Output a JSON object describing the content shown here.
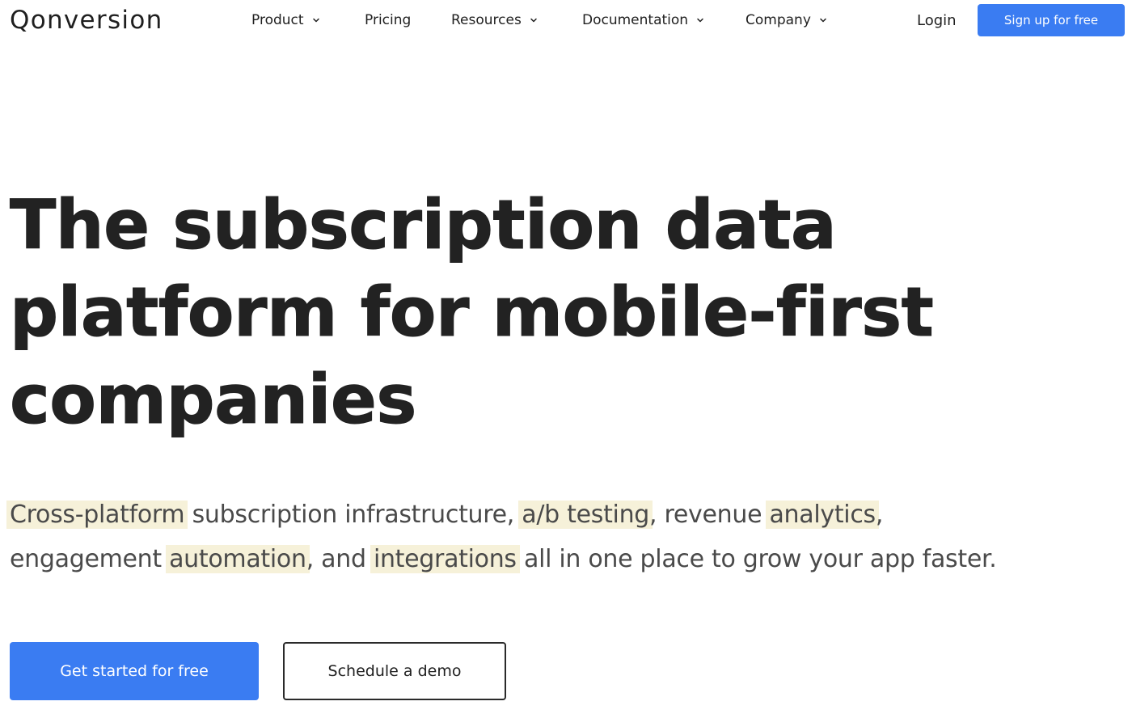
{
  "header": {
    "logo": "Qonversion",
    "nav": [
      {
        "label": "Product",
        "has_dropdown": true,
        "icon": "chevron-down-icon"
      },
      {
        "label": "Pricing",
        "has_dropdown": false
      },
      {
        "label": "Resources",
        "has_dropdown": true,
        "icon": "chevron-down-icon"
      },
      {
        "label": "Documentation",
        "has_dropdown": true,
        "icon": "chevron-down-icon"
      },
      {
        "label": "Company",
        "has_dropdown": true,
        "icon": "chevron-down-icon"
      }
    ],
    "login_label": "Login",
    "signup_label": "Sign up for free"
  },
  "hero": {
    "headline_lines": [
      "The subscription data",
      "platform for mobile-first",
      "companies"
    ],
    "subtitle": {
      "line1": {
        "hl1": "Cross-platform",
        "t1": " subscription infrastructure, ",
        "hl2": "a/b testing",
        "t2": ", revenue ",
        "hl3": "analytics",
        "t3": ","
      },
      "line2": {
        "t0": "engagement ",
        "hl1": "automation",
        "t1": ", and ",
        "hl2": "integrations",
        "t2": " all in one place to grow your app faster."
      }
    },
    "cta_primary": "Get started for free",
    "cta_secondary": "Schedule a demo"
  },
  "colors": {
    "accent": "#3a7cf2",
    "highlight": "#f6f1d9",
    "text": "#1f1f1f"
  }
}
